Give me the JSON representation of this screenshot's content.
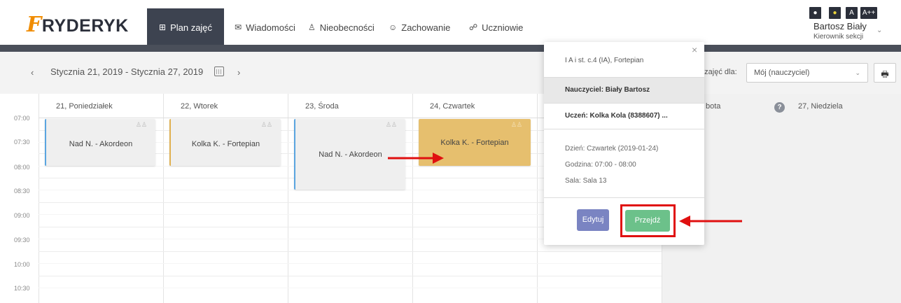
{
  "header": {
    "logo": {
      "glyph": "F",
      "text": "RYDERYK"
    },
    "nav": [
      {
        "label": "Plan zajęć",
        "icon": "⊞",
        "icon_name": "grid-icon",
        "active": true
      },
      {
        "label": "Wiadomości",
        "icon": "✉",
        "icon_name": "envelope-icon"
      },
      {
        "label": "Nieobecności",
        "icon": "♙",
        "icon_name": "user-icon"
      },
      {
        "label": "Zachowanie",
        "icon": "☺",
        "icon_name": "smiley-icon"
      },
      {
        "label": "Uczniowie",
        "icon": "☍",
        "icon_name": "users-icon"
      }
    ],
    "accessibility": [
      "●",
      "●",
      "A",
      "A++"
    ],
    "user": {
      "name": "Bartosz Biały",
      "role": "Kierownik sekcji"
    }
  },
  "toolbar": {
    "prev": "‹",
    "date_range": "Stycznia 21, 2019 - Stycznia 27, 2019",
    "next": "›",
    "plan_label": "n zajęć dla:",
    "select_value": "Mój (nauczyciel)",
    "print_icon": "🖶"
  },
  "calendar": {
    "times": [
      "07:00",
      "07:30",
      "08:00",
      "08:30",
      "09:00",
      "09:30",
      "10:00",
      "10:30"
    ],
    "days": [
      "21, Poniedziałek",
      "22, Wtorek",
      "23, Środa",
      "24, Czwartek",
      "bota",
      "27, Niedziela"
    ],
    "events": [
      {
        "label": "Nad N. - Akordeon",
        "color": "#efefef",
        "border": "#5aa5e0"
      },
      {
        "label": "Kolka K. - Fortepian",
        "color": "#efefef",
        "border": "#e0b050"
      },
      {
        "label": "Nad N. - Akordeon",
        "color": "#efefef",
        "border": "#5aa5e0"
      },
      {
        "label": "Kolka K. - Fortepian",
        "color": "#e6bf6e",
        "border": "#e6bf6e"
      }
    ]
  },
  "popover": {
    "close": "×",
    "course": "I A i st. c.4 (IA), Fortepian",
    "teacher": "Nauczyciel: Biały Bartosz",
    "student": "Uczeń: Kolka Kola (8388607) ...",
    "day": "Dzień: Czwartek (2019-01-24)",
    "hour": "Godzina: 07:00 - 08:00",
    "room": "Sala: Sala 13",
    "edit_label": "Edytuj",
    "go_label": "Przejdź"
  },
  "annotations": {
    "highlight_color": "#e01010"
  }
}
